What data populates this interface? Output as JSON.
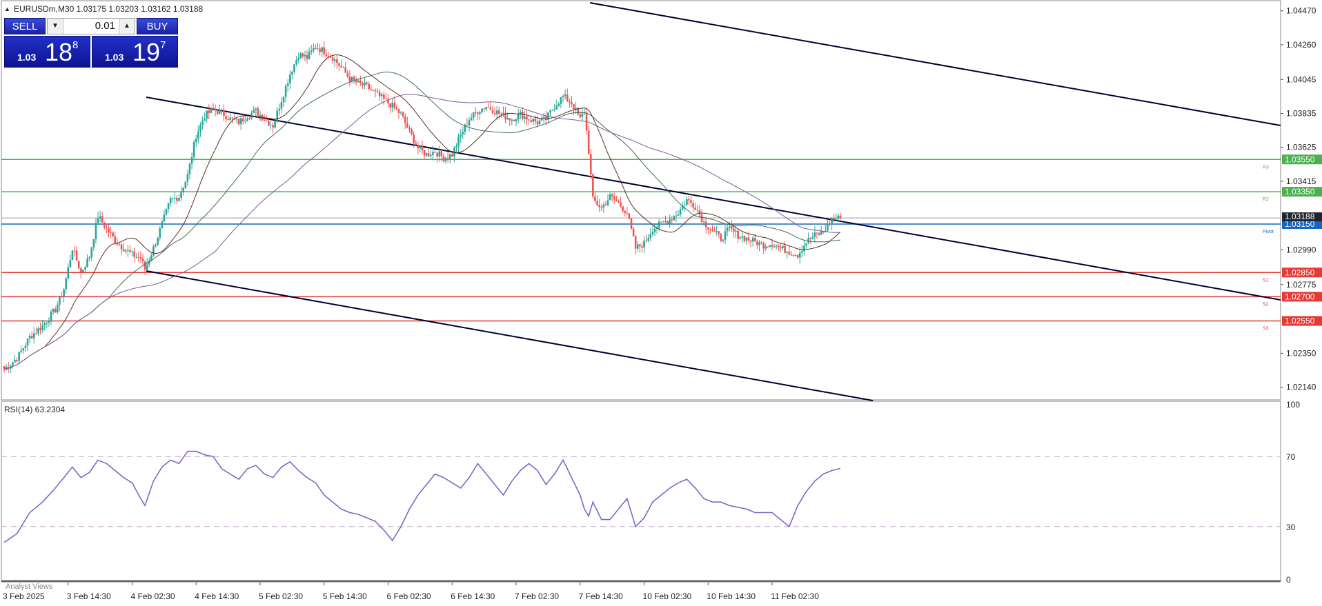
{
  "header": {
    "arrow": "▲",
    "title": "EURUSDm,M30  1.03175 1.03203 1.03162 1.03188"
  },
  "trade_panel": {
    "sell_label": "SELL",
    "buy_label": "BUY",
    "lot_value": "0.01",
    "lot_down_icon": "triangle-down",
    "lot_up_icon": "triangle-up",
    "sell_price_small": "1.03",
    "sell_price_big": "18",
    "sell_price_sup": "8",
    "buy_price_small": "1.03",
    "buy_price_big": "19",
    "buy_price_sup": "7"
  },
  "rsi_label": "RSI(14) 63.2304",
  "bottom_label": "Analyst Views",
  "colors": {
    "bull": "#26a69a",
    "bear": "#ef5350",
    "resistance": "#4caf50",
    "support": "#e53935",
    "pivot": "#1565c0",
    "trend": "#000033",
    "rsi": "#7b68c8",
    "ma_dark": "#5b2c2c",
    "ma_mid": "#3e6b55",
    "ma_purple": "#7a5a9a"
  },
  "chart_data": [
    {
      "type": "candlestick",
      "symbol": "EURUSDm",
      "timeframe": "M30",
      "ohlc_current": {
        "open": 1.03175,
        "high": 1.03203,
        "low": 1.03162,
        "close": 1.03188
      },
      "ylim": [
        1.0207,
        1.0452
      ],
      "y_ticks": [
        "1.04470",
        "1.04260",
        "1.04045",
        "1.03835",
        "1.03625",
        "1.03415",
        "1.02990",
        "1.02775",
        "1.02350",
        "1.02140"
      ],
      "x_tick_labels": [
        "3 Feb 2025",
        "3 Feb 14:30",
        "4 Feb 02:30",
        "4 Feb 14:30",
        "5 Feb 02:30",
        "5 Feb 14:30",
        "6 Feb 02:30",
        "6 Feb 14:30",
        "7 Feb 02:30",
        "7 Feb 14:30",
        "10 Feb 02:30",
        "10 Feb 14:30",
        "11 Feb 02:30"
      ],
      "current_price": {
        "label": "1.03188",
        "value": 1.03188
      },
      "levels": [
        {
          "name": "R3",
          "value": 1.0355,
          "label": "1.03550",
          "kind": "resistance"
        },
        {
          "name": "R2",
          "value": 1.0335,
          "label": "1.03350",
          "kind": "resistance"
        },
        {
          "name": "Pivot",
          "value": 1.0315,
          "label": "1.03150",
          "kind": "pivot"
        },
        {
          "name": "S1",
          "value": 1.0285,
          "label": "1.02850",
          "kind": "support"
        },
        {
          "name": "S2",
          "value": 1.027,
          "label": "1.02700",
          "kind": "support"
        },
        {
          "name": "S3",
          "value": 1.0255,
          "label": "1.02550",
          "kind": "support"
        }
      ],
      "close_path": [
        [
          0,
          1.0225
        ],
        [
          6,
          1.0232
        ],
        [
          12,
          1.0245
        ],
        [
          18,
          1.0252
        ],
        [
          24,
          1.0262
        ],
        [
          28,
          1.0275
        ],
        [
          32,
          1.03
        ],
        [
          36,
          1.0285
        ],
        [
          40,
          1.0295
        ],
        [
          44,
          1.032
        ],
        [
          48,
          1.0312
        ],
        [
          52,
          1.0305
        ],
        [
          56,
          1.03
        ],
        [
          60,
          1.0296
        ],
        [
          64,
          1.0294
        ],
        [
          66,
          1.0287
        ],
        [
          70,
          1.03
        ],
        [
          74,
          1.0315
        ],
        [
          78,
          1.033
        ],
        [
          82,
          1.0332
        ],
        [
          86,
          1.0345
        ],
        [
          90,
          1.037
        ],
        [
          94,
          1.0382
        ],
        [
          98,
          1.0386
        ],
        [
          102,
          1.0384
        ],
        [
          106,
          1.038
        ],
        [
          110,
          1.0378
        ],
        [
          114,
          1.0382
        ],
        [
          118,
          1.0385
        ],
        [
          122,
          1.038
        ],
        [
          126,
          1.0376
        ],
        [
          130,
          1.0392
        ],
        [
          134,
          1.0408
        ],
        [
          138,
          1.042
        ],
        [
          142,
          1.0418
        ],
        [
          146,
          1.0425
        ],
        [
          150,
          1.0422
        ],
        [
          154,
          1.0418
        ],
        [
          158,
          1.0412
        ],
        [
          162,
          1.0405
        ],
        [
          166,
          1.0402
        ],
        [
          170,
          1.04
        ],
        [
          174,
          1.0396
        ],
        [
          178,
          1.0392
        ],
        [
          182,
          1.0388
        ],
        [
          186,
          1.0383
        ],
        [
          190,
          1.0372
        ],
        [
          194,
          1.0362
        ],
        [
          198,
          1.0358
        ],
        [
          202,
          1.036
        ],
        [
          206,
          1.0356
        ],
        [
          210,
          1.0358
        ],
        [
          214,
          1.037
        ],
        [
          218,
          1.038
        ],
        [
          222,
          1.0385
        ],
        [
          226,
          1.0388
        ],
        [
          230,
          1.0385
        ],
        [
          234,
          1.0382
        ],
        [
          238,
          1.038
        ],
        [
          242,
          1.0383
        ],
        [
          246,
          1.038
        ],
        [
          250,
          1.0378
        ],
        [
          254,
          1.038
        ],
        [
          258,
          1.0388
        ],
        [
          262,
          1.0394
        ],
        [
          266,
          1.039
        ],
        [
          270,
          1.038
        ],
        [
          272,
          1.0385
        ],
        [
          274,
          1.036
        ],
        [
          276,
          1.033
        ],
        [
          280,
          1.0325
        ],
        [
          284,
          1.0332
        ],
        [
          288,
          1.0328
        ],
        [
          292,
          1.0322
        ],
        [
          296,
          1.03
        ],
        [
          300,
          1.0303
        ],
        [
          304,
          1.0312
        ],
        [
          308,
          1.0315
        ],
        [
          312,
          1.0318
        ],
        [
          316,
          1.0322
        ],
        [
          320,
          1.033
        ],
        [
          324,
          1.0326
        ],
        [
          328,
          1.0316
        ],
        [
          332,
          1.0311
        ],
        [
          336,
          1.0306
        ],
        [
          340,
          1.0312
        ],
        [
          344,
          1.0308
        ],
        [
          348,
          1.0306
        ],
        [
          352,
          1.0304
        ],
        [
          356,
          1.0302
        ],
        [
          360,
          1.0303
        ],
        [
          364,
          1.03
        ],
        [
          368,
          1.0298
        ],
        [
          372,
          1.0296
        ],
        [
          376,
          1.0304
        ],
        [
          380,
          1.0308
        ],
        [
          384,
          1.031
        ],
        [
          388,
          1.0318
        ],
        [
          392,
          1.03188
        ]
      ]
    },
    {
      "type": "line",
      "name": "RSI(14)",
      "value_label": "63.2304",
      "ylim": [
        0,
        100
      ],
      "y_ticks": [
        "100",
        "70",
        "30",
        "0"
      ],
      "levels": [
        70,
        30
      ],
      "values": [
        [
          0,
          21
        ],
        [
          6,
          26
        ],
        [
          12,
          38
        ],
        [
          18,
          44
        ],
        [
          24,
          52
        ],
        [
          28,
          58
        ],
        [
          32,
          64
        ],
        [
          36,
          58
        ],
        [
          40,
          61
        ],
        [
          44,
          68
        ],
        [
          48,
          66
        ],
        [
          52,
          62
        ],
        [
          56,
          58
        ],
        [
          60,
          55
        ],
        [
          64,
          46
        ],
        [
          66,
          42
        ],
        [
          70,
          56
        ],
        [
          74,
          64
        ],
        [
          78,
          68
        ],
        [
          82,
          66
        ],
        [
          86,
          73
        ],
        [
          90,
          73
        ],
        [
          94,
          71
        ],
        [
          98,
          70
        ],
        [
          102,
          63
        ],
        [
          106,
          60
        ],
        [
          110,
          57
        ],
        [
          114,
          63
        ],
        [
          118,
          65
        ],
        [
          122,
          60
        ],
        [
          126,
          58
        ],
        [
          130,
          64
        ],
        [
          134,
          67
        ],
        [
          138,
          62
        ],
        [
          142,
          58
        ],
        [
          146,
          55
        ],
        [
          150,
          48
        ],
        [
          154,
          44
        ],
        [
          158,
          40
        ],
        [
          162,
          38
        ],
        [
          166,
          37
        ],
        [
          170,
          35
        ],
        [
          174,
          33
        ],
        [
          178,
          28
        ],
        [
          182,
          22
        ],
        [
          186,
          30
        ],
        [
          190,
          40
        ],
        [
          194,
          48
        ],
        [
          198,
          54
        ],
        [
          202,
          60
        ],
        [
          206,
          58
        ],
        [
          210,
          55
        ],
        [
          214,
          52
        ],
        [
          218,
          58
        ],
        [
          222,
          66
        ],
        [
          226,
          60
        ],
        [
          230,
          54
        ],
        [
          234,
          48
        ],
        [
          238,
          56
        ],
        [
          242,
          62
        ],
        [
          246,
          66
        ],
        [
          250,
          62
        ],
        [
          254,
          54
        ],
        [
          258,
          60
        ],
        [
          262,
          68
        ],
        [
          266,
          58
        ],
        [
          270,
          48
        ],
        [
          272,
          40
        ],
        [
          274,
          36
        ],
        [
          276,
          44
        ],
        [
          280,
          34
        ],
        [
          284,
          34
        ],
        [
          288,
          40
        ],
        [
          292,
          46
        ],
        [
          296,
          30
        ],
        [
          300,
          35
        ],
        [
          304,
          44
        ],
        [
          308,
          48
        ],
        [
          312,
          52
        ],
        [
          316,
          55
        ],
        [
          320,
          57
        ],
        [
          324,
          52
        ],
        [
          328,
          46
        ],
        [
          332,
          44
        ],
        [
          336,
          44
        ],
        [
          340,
          42
        ],
        [
          344,
          41
        ],
        [
          348,
          40
        ],
        [
          352,
          38
        ],
        [
          356,
          38
        ],
        [
          360,
          38
        ],
        [
          364,
          34
        ],
        [
          368,
          30
        ],
        [
          372,
          42
        ],
        [
          376,
          50
        ],
        [
          380,
          56
        ],
        [
          384,
          60
        ],
        [
          388,
          62
        ],
        [
          392,
          63.2304
        ]
      ]
    }
  ]
}
